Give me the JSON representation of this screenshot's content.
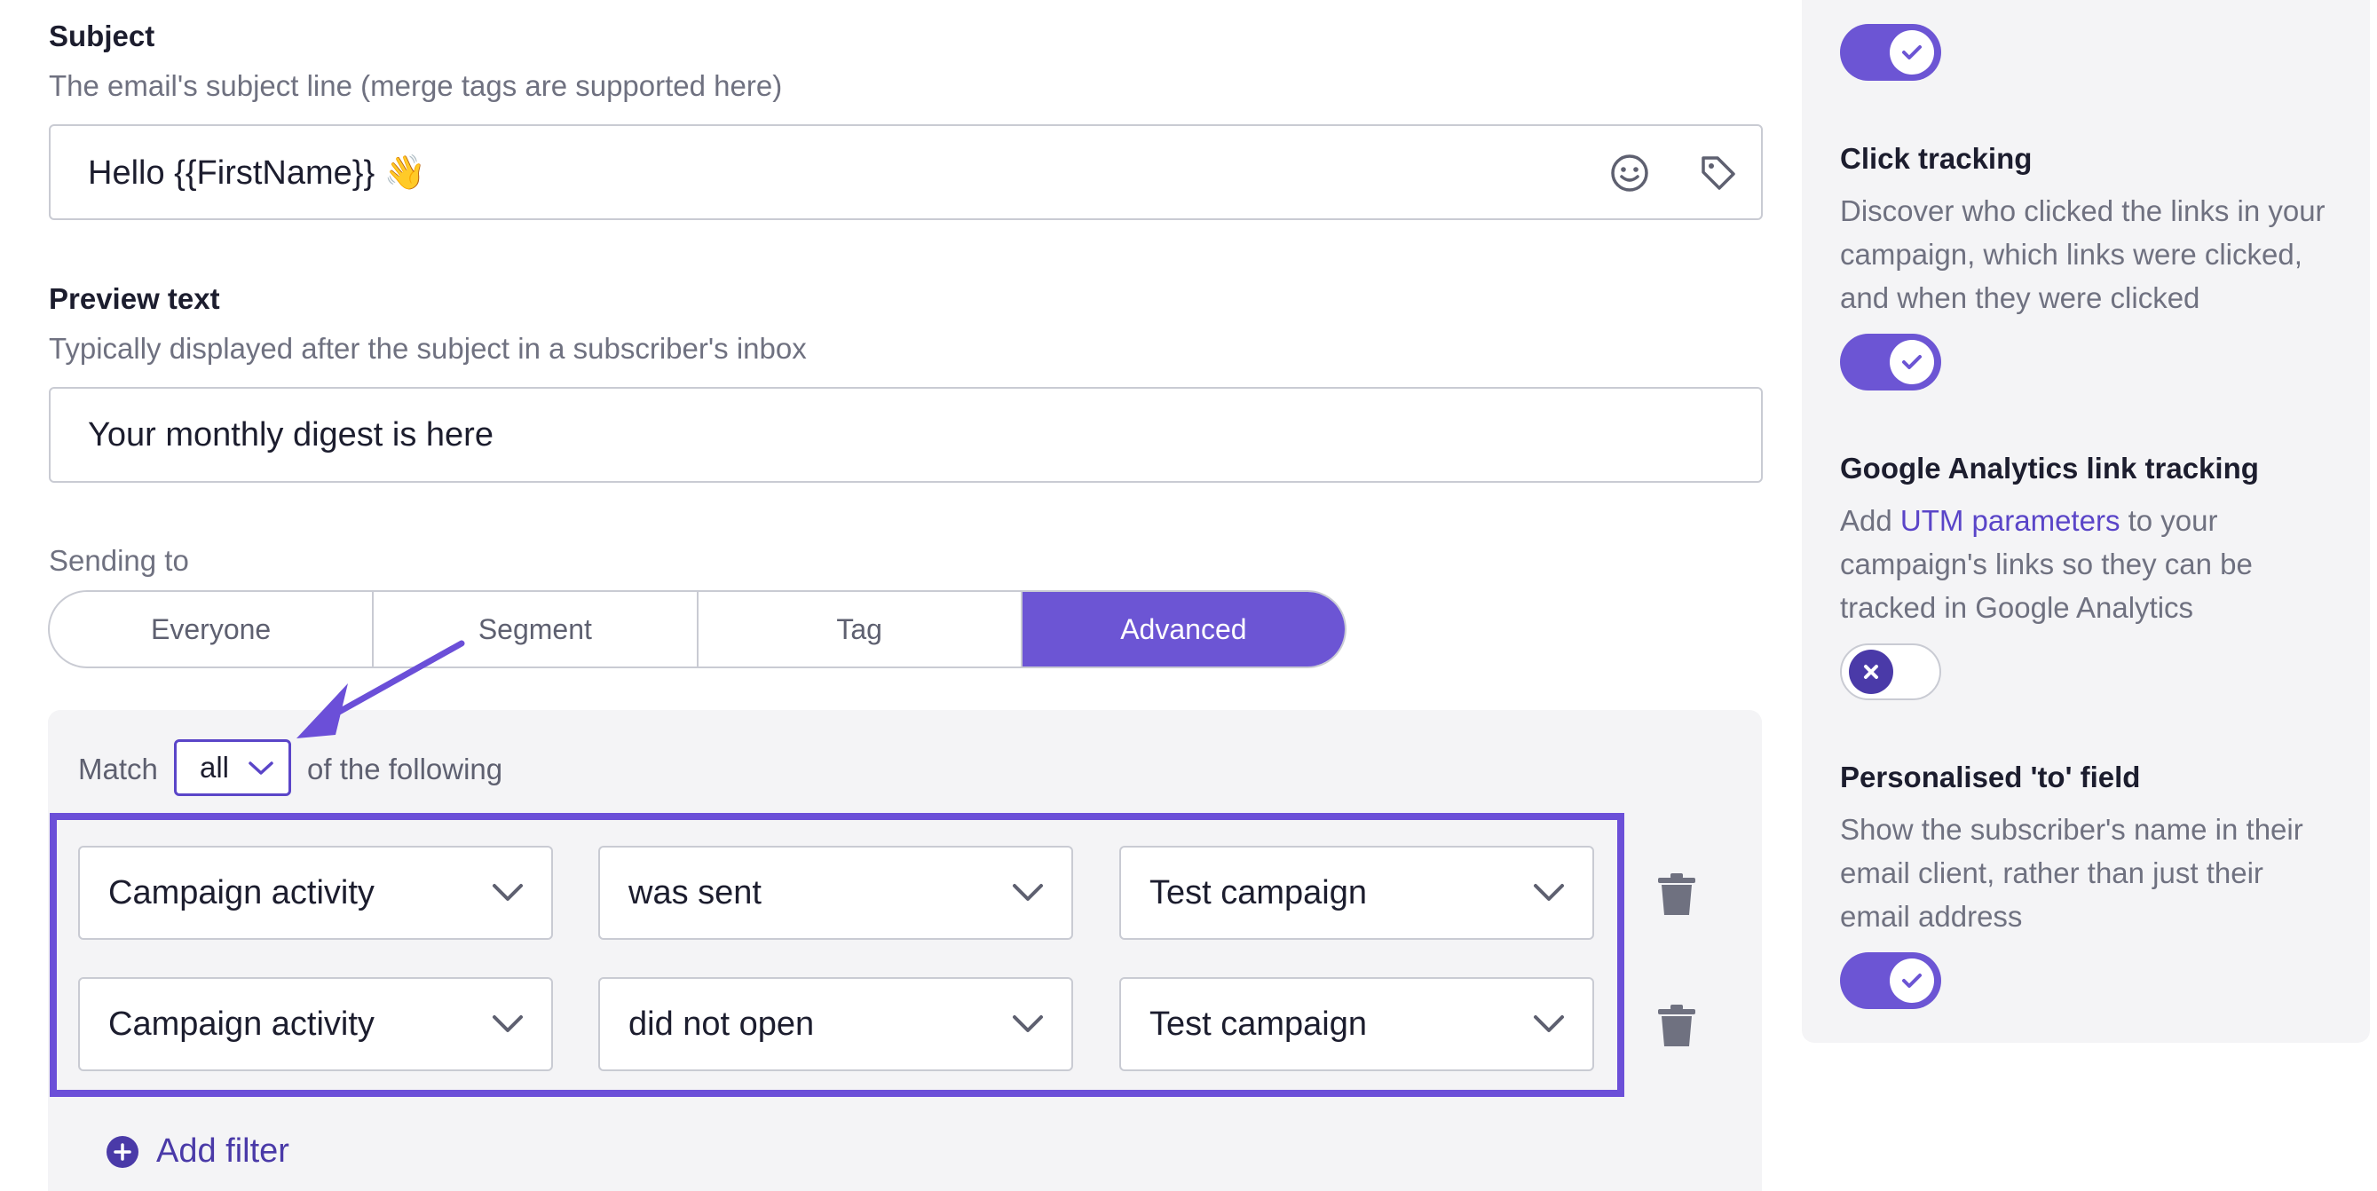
{
  "subject": {
    "label": "Subject",
    "description": "The email's subject line (merge tags are supported here)",
    "value": "Hello {{FirstName}}",
    "emoji": "👋"
  },
  "preview": {
    "label": "Preview text",
    "description": "Typically displayed after the subject in a subscriber's inbox",
    "value": "Your monthly digest is here"
  },
  "sending_to": {
    "label": "Sending to",
    "options": [
      "Everyone",
      "Segment",
      "Tag",
      "Advanced"
    ],
    "selected": "Advanced"
  },
  "match": {
    "prefix": "Match",
    "value": "all",
    "suffix": "of the following"
  },
  "filters": [
    {
      "field": "Campaign activity",
      "condition": "was sent",
      "campaign": "Test campaign"
    },
    {
      "field": "Campaign activity",
      "condition": "did not open",
      "campaign": "Test campaign"
    }
  ],
  "add_filter_label": "Add filter",
  "settings": {
    "click_tracking": {
      "title": "Click tracking",
      "description": "Discover who clicked the links in your campaign, which links were clicked, and when they were clicked",
      "enabled": true
    },
    "ga_tracking": {
      "title": "Google Analytics link tracking",
      "desc_before": "Add ",
      "link_text": "UTM parameters",
      "desc_after": " to your campaign's links so they can be tracked in Google Analytics",
      "enabled": false
    },
    "personalised_to": {
      "title": "Personalised 'to' field",
      "description": "Show the subscriber's name in their email client, rather than just their email address",
      "enabled": true
    },
    "top_toggle_enabled": true
  },
  "colors": {
    "accent": "#6c55d4",
    "highlight": "#6b4fd8",
    "panel": "#f4f4f6"
  }
}
